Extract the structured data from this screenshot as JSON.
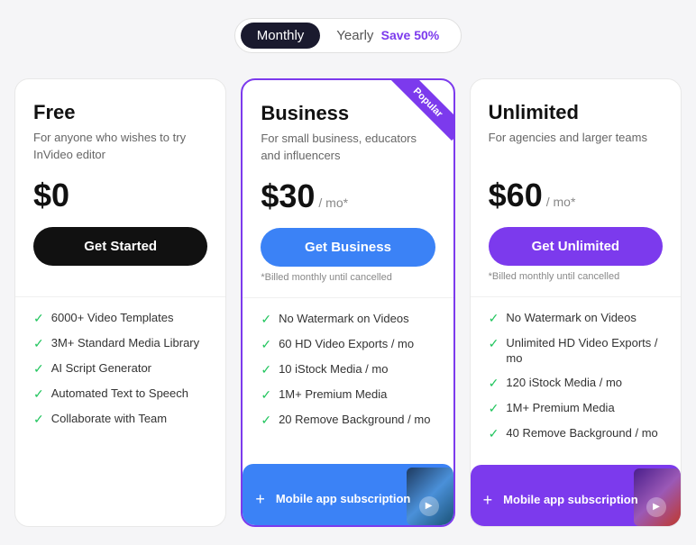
{
  "billing_toggle": {
    "monthly_label": "Monthly",
    "yearly_label": "Yearly",
    "save_label": "Save 50%",
    "active": "monthly"
  },
  "plans": [
    {
      "id": "free",
      "title": "Free",
      "description": "For anyone who wishes to try InVideo editor",
      "price": "$0",
      "price_period": "",
      "cta_label": "Get Started",
      "cta_type": "black",
      "billed_note": "",
      "highlighted": false,
      "popular": false,
      "features": [
        "6000+ Video Templates",
        "3M+ Standard Media Library",
        "AI Script Generator",
        "Automated Text to Speech",
        "Collaborate with Team"
      ],
      "mobile_banner": null
    },
    {
      "id": "business",
      "title": "Business",
      "description": "For small business, educators and influencers",
      "price": "$30",
      "price_period": "/ mo*",
      "cta_label": "Get Business",
      "cta_type": "blue",
      "billed_note": "*Billed monthly until cancelled",
      "highlighted": true,
      "popular": true,
      "features": [
        "No Watermark on Videos",
        "60 HD Video Exports / mo",
        "10 iStock Media / mo",
        "1M+ Premium Media",
        "20 Remove Background / mo"
      ],
      "mobile_banner": {
        "text": "Mobile app subscription",
        "bg_type": "blue"
      }
    },
    {
      "id": "unlimited",
      "title": "Unlimited",
      "description": "For agencies and larger teams",
      "price": "$60",
      "price_period": "/ mo*",
      "cta_label": "Get Unlimited",
      "cta_type": "purple",
      "billed_note": "*Billed monthly until cancelled",
      "highlighted": false,
      "popular": false,
      "features": [
        "No Watermark on Videos",
        "Unlimited HD Video Exports / mo",
        "120 iStock Media / mo",
        "1M+ Premium Media",
        "40 Remove Background / mo"
      ],
      "mobile_banner": {
        "text": "Mobile app subscription",
        "bg_type": "purple"
      }
    }
  ],
  "icons": {
    "check": "✓",
    "plus": "+",
    "play": "▶"
  }
}
